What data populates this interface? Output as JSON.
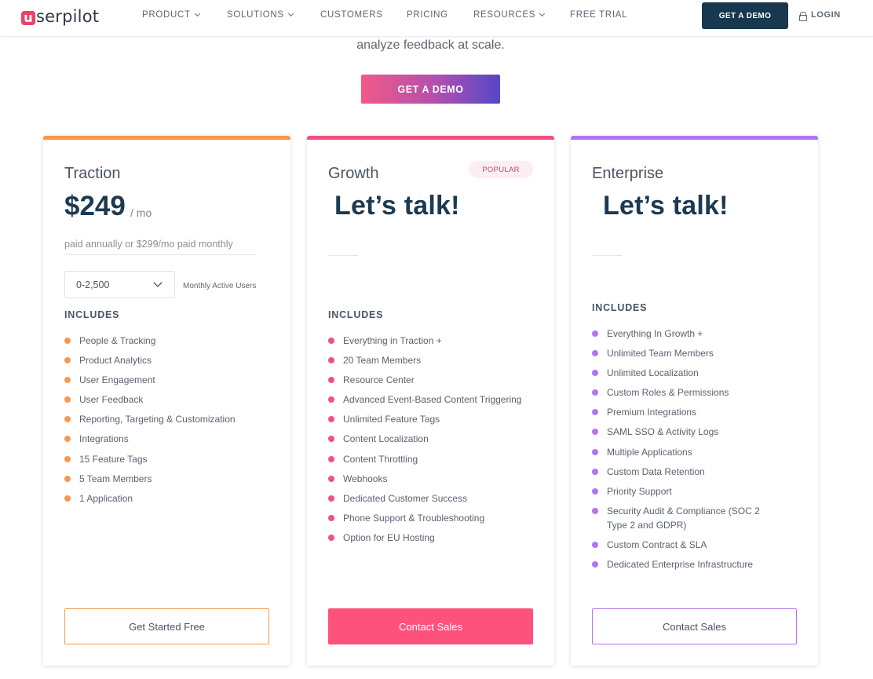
{
  "brand": {
    "logo_letter": "u",
    "logo_rest": "serpilot"
  },
  "nav": {
    "items": [
      {
        "label": "PRODUCT",
        "has_dropdown": true
      },
      {
        "label": "SOLUTIONS",
        "has_dropdown": true
      },
      {
        "label": "CUSTOMERS",
        "has_dropdown": false
      },
      {
        "label": "PRICING",
        "has_dropdown": false
      },
      {
        "label": "RESOURCES",
        "has_dropdown": true
      },
      {
        "label": "FREE TRIAL",
        "has_dropdown": false
      }
    ],
    "demo_label": "GET A DEMO",
    "login_label": "LOGIN"
  },
  "hero": {
    "tagline": "analyze feedback at scale.",
    "button_label": "GET A DEMO"
  },
  "plans": [
    {
      "name": "Traction",
      "accent": "#f6994f",
      "price": "$249",
      "per": "/ mo",
      "billing_note": "paid annually or $299/mo paid monthly",
      "mau_value": "0-2,500",
      "mau_label": "Monthly Active Users",
      "includes_label": "INCLUDES",
      "features": [
        "People & Tracking",
        "Product Analytics",
        "User Engagement",
        "User Feedback",
        "Reporting, Targeting & Customization",
        "Integrations",
        "15 Feature Tags",
        "5 Team Members",
        "1 Application"
      ],
      "cta_label": "Get Started Free"
    },
    {
      "name": "Growth",
      "accent": "#f2517f",
      "badge": "POPULAR",
      "headline": "Let’s talk!",
      "includes_label": "INCLUDES",
      "features": [
        "Everything in Traction +",
        "20 Team Members",
        "Resource Center",
        "Advanced Event-Based Content Triggering",
        "Unlimited Feature Tags",
        "Content Localization",
        "Content Throttling",
        "Webhooks",
        "Dedicated Customer Success",
        "Phone Support & Troubleshooting",
        "Option for EU Hosting"
      ],
      "cta_label": "Contact Sales"
    },
    {
      "name": "Enterprise",
      "accent": "#b474f2",
      "headline": "Let’s talk!",
      "includes_label": "INCLUDES",
      "features": [
        "Everything In Growth +",
        "Unlimited Team Members",
        "Unlimited Localization",
        "Custom Roles & Permissions",
        "Premium Integrations",
        "SAML SSO & Activity Logs",
        "Multiple Applications",
        "Custom Data Retention",
        "Priority Support",
        "Security Audit & Compliance (SOC 2 Type 2 and GDPR)",
        "Custom Contract & SLA",
        "Dedicated Enterprise Infrastructure"
      ],
      "cta_label": "Contact Sales"
    }
  ],
  "colors": {
    "navy": "#17384f",
    "brand_pink": "#e9436a",
    "traction_orange": "#f6994f",
    "growth_pink": "#f2517f",
    "enterprise_purple": "#b474f2"
  },
  "icons": [
    "chevron-down-icon",
    "lock-icon",
    "dropdown-chevron-icon",
    "bullet-dot-icon"
  ]
}
